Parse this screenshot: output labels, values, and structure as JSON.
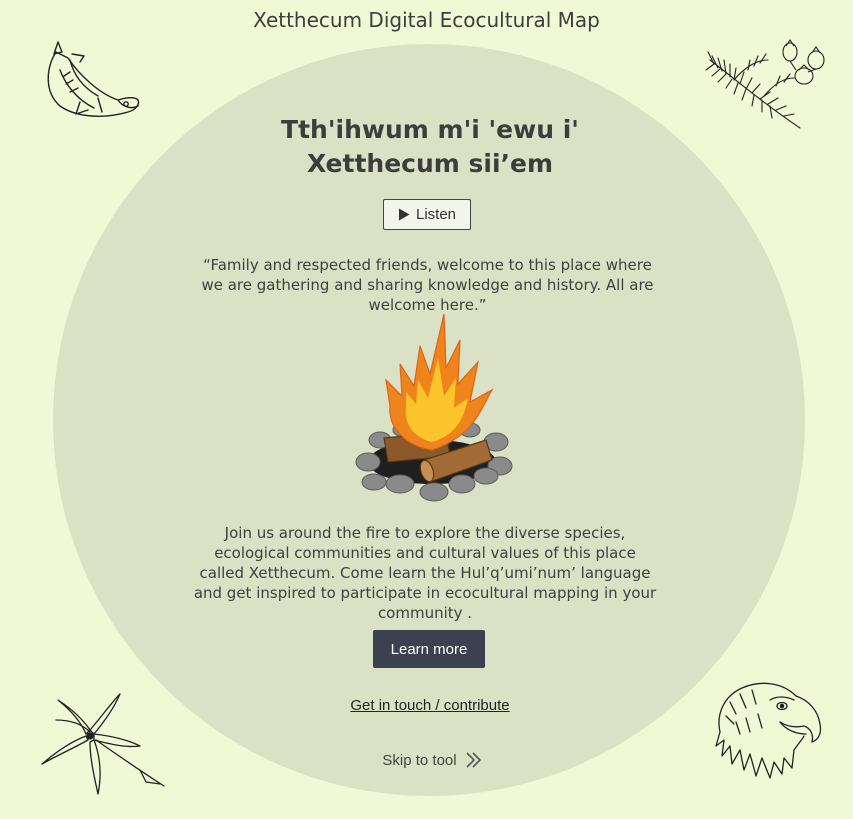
{
  "header": {
    "site_title": "Xetthecum Digital Ecocultural Map"
  },
  "welcome": {
    "heading_line1": "Tth'ihwum m'i 'ewu i'",
    "heading_line2": "Xetthecum sii’em",
    "listen_label": "Listen",
    "quote": "“Family and respected friends, welcome to this place where we are gathering and sharing knowledge and history. All are welcome here.”",
    "intro": "Join us around the fire to explore the diverse species, ecological communities and cultural values of this place called Xetthecum. Come learn the Hul’q’umi’num’ language and get inspired to participate in ecocultural mapping in your community .",
    "learn_more_label": "Learn more",
    "contact_label": "Get in touch / contribute",
    "skip_label": "Skip to tool"
  },
  "icons": {
    "play": "play-icon",
    "skip": "double-chevron-right-icon",
    "illustrations": [
      "salmon-icon",
      "cedar-branch-icon",
      "camas-flower-icon",
      "eagle-icon",
      "campfire-icon"
    ]
  },
  "colors": {
    "background": "#f1f8d5",
    "circle": "#dbe1c4",
    "button_dark": "#3c4150",
    "flame_outer": "#f0841c",
    "flame_inner": "#fbc42a"
  }
}
